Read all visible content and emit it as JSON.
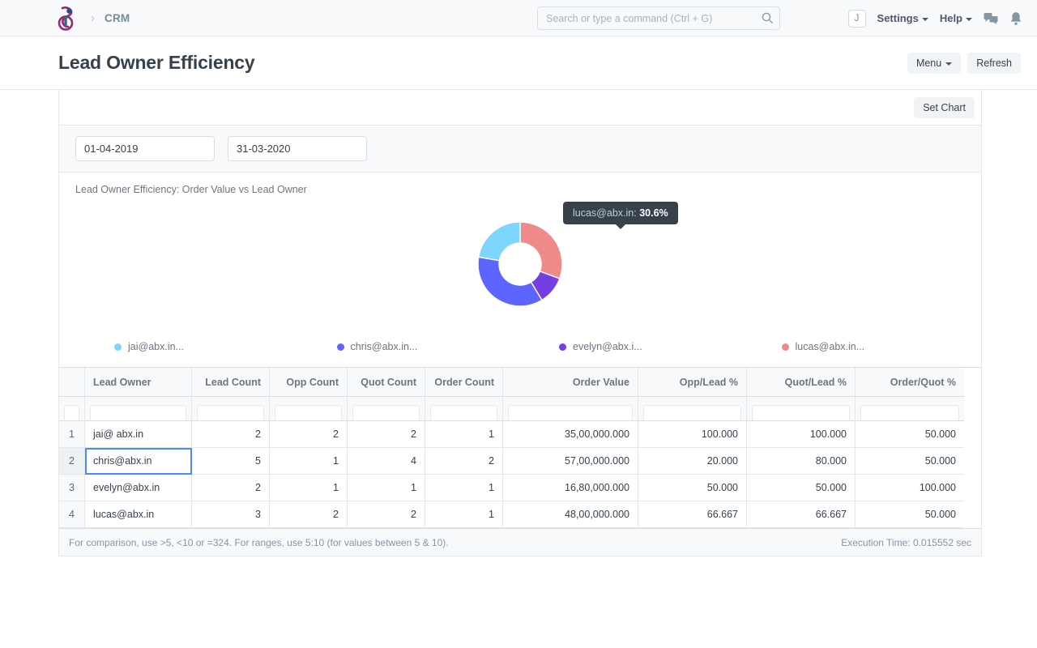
{
  "navbar": {
    "breadcrumb": "CRM",
    "search": {
      "placeholder": "Search or type a command (Ctrl + G)",
      "value": ""
    },
    "avatar_initial": "J",
    "settings_label": "Settings",
    "help_label": "Help"
  },
  "page": {
    "title": "Lead Owner Efficiency",
    "menu_label": "Menu",
    "refresh_label": "Refresh",
    "set_chart_label": "Set Chart"
  },
  "filters": {
    "from_date": "01-04-2019",
    "to_date": "31-03-2020"
  },
  "chart_data": {
    "type": "pie",
    "variant": "donut",
    "title": "Lead Owner Efficiency: Order Value vs Lead Owner",
    "legend_position": "bottom",
    "labels": [
      "jai@abx.in...",
      "chris@abx.in...",
      "evelyn@abx.i...",
      "lucas@abx.in..."
    ],
    "values": [
      35000000,
      57000000,
      16800000,
      48000000
    ],
    "percentages": [
      22.3,
      36.3,
      10.7,
      30.6
    ],
    "colors": [
      "#7cd6fd",
      "#5e64ff",
      "#743ee2",
      "#ef8a8a"
    ],
    "tooltip": {
      "label": "lucas@abx.in:",
      "value": "30.6%"
    }
  },
  "table": {
    "columns": [
      {
        "key": "idx",
        "label": ""
      },
      {
        "key": "lead_owner",
        "label": "Lead Owner"
      },
      {
        "key": "lead_count",
        "label": "Lead Count"
      },
      {
        "key": "opp_count",
        "label": "Opp Count"
      },
      {
        "key": "quot_count",
        "label": "Quot Count"
      },
      {
        "key": "order_count",
        "label": "Order Count"
      },
      {
        "key": "order_value",
        "label": "Order Value"
      },
      {
        "key": "opp_lead",
        "label": "Opp/Lead %"
      },
      {
        "key": "quot_lead",
        "label": "Quot/Lead %"
      },
      {
        "key": "order_quot",
        "label": "Order/Quot %"
      }
    ],
    "rows": [
      {
        "idx": "1",
        "lead_owner": "jai@ abx.in",
        "lead_count": "2",
        "opp_count": "2",
        "quot_count": "2",
        "order_count": "1",
        "order_value": "35,00,000.000",
        "opp_lead": "100.000",
        "quot_lead": "100.000",
        "order_quot": "50.000"
      },
      {
        "idx": "2",
        "lead_owner": "chris@abx.in",
        "lead_count": "5",
        "opp_count": "1",
        "quot_count": "4",
        "order_count": "2",
        "order_value": "57,00,000.000",
        "opp_lead": "20.000",
        "quot_lead": "80.000",
        "order_quot": "50.000"
      },
      {
        "idx": "3",
        "lead_owner": "evelyn@abx.in",
        "lead_count": "2",
        "opp_count": "1",
        "quot_count": "1",
        "order_count": "1",
        "order_value": "16,80,000.000",
        "opp_lead": "50.000",
        "quot_lead": "50.000",
        "order_quot": "100.000"
      },
      {
        "idx": "4",
        "lead_owner": "lucas@abx.in",
        "lead_count": "3",
        "opp_count": "2",
        "quot_count": "2",
        "order_count": "1",
        "order_value": "48,00,000.000",
        "opp_lead": "66.667",
        "quot_lead": "66.667",
        "order_quot": "50.000"
      }
    ],
    "selected_row": 1,
    "selected_column": "lead_owner",
    "footer_hint": "For comparison, use >5, <10 or =324. For ranges, use 5:10 (for values between 5 & 10).",
    "execution_time": "Execution Time: 0.015552 sec"
  }
}
